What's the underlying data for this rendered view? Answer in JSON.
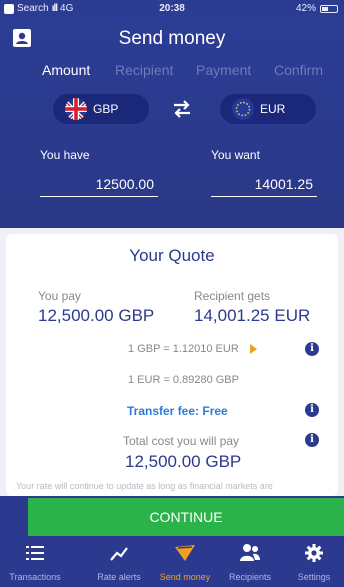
{
  "status_bar": {
    "carrier": "Search",
    "signal": "ıll",
    "network": "4G",
    "time": "20:38",
    "battery": "42%",
    "battery_level": 0.42
  },
  "header": {
    "title": "Send money",
    "steps": [
      "Amount",
      "Recipient",
      "Payment",
      "Confirm"
    ],
    "active_step": "Amount"
  },
  "currencies": {
    "from": "GBP",
    "to": "EUR"
  },
  "amounts": {
    "you_have_label": "You have",
    "you_have_value": "12500.00",
    "you_want_label": "You want",
    "you_want_value": "14001.25"
  },
  "quote": {
    "title": "Your Quote",
    "you_pay_label": "You pay",
    "you_pay_value": "12,500.00 GBP",
    "recipient_gets_label": "Recipient gets",
    "recipient_gets_value": "14,001.25 EUR",
    "rate_gbp_eur": "1 GBP = 1.12010 EUR",
    "rate_eur_gbp": "1 EUR = 0.89280 GBP",
    "transfer_fee": "Transfer fee: Free",
    "total_label": "Total cost you will pay",
    "total_value": "12,500.00 GBP",
    "disclaimer": "Your rate will continue to update as long as financial markets are"
  },
  "continue_label": "CONTINUE",
  "tabs": [
    {
      "label": "Transactions",
      "icon": "list-icon"
    },
    {
      "label": "Rate alerts",
      "icon": "trend-icon"
    },
    {
      "label": "Send money",
      "icon": "send-icon"
    },
    {
      "label": "Recipients",
      "icon": "people-icon"
    },
    {
      "label": "Settings",
      "icon": "gear-icon"
    }
  ],
  "colors": {
    "header_bg": "#2b3a8f",
    "accent_green": "#2cb24a",
    "accent_orange": "#f0a020",
    "quote_blue": "#2b3a8f",
    "fee_blue": "#2f7bd6"
  }
}
